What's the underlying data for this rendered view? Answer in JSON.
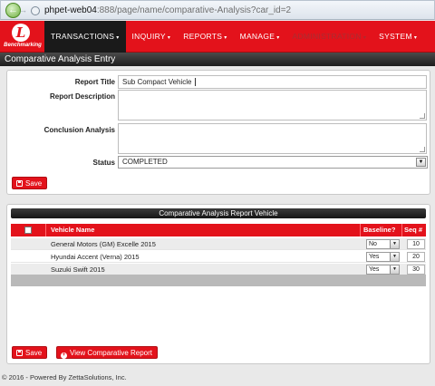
{
  "browser": {
    "url_host": "phpet-web04",
    "url_rest": ":888/page/name/comparative-Analysis?car_id=2"
  },
  "nav": {
    "logo_letter": "L",
    "logo_text": "Benchmarking",
    "items": [
      {
        "label": "TRANSACTIONS",
        "active": true
      },
      {
        "label": "INQUIRY"
      },
      {
        "label": "REPORTS"
      },
      {
        "label": "MANAGE"
      },
      {
        "label": "ADMINISTRATION",
        "dim": true
      },
      {
        "label": "SYSTEM"
      }
    ],
    "caret": "▾"
  },
  "page_title": "Comparative Analysis Entry",
  "form": {
    "report_title_label": "Report Title",
    "report_title_value": "Sub Compact Vehicle",
    "report_description_label": "Report Description",
    "report_description_value": "",
    "conclusion_label": "Conclusion Analysis",
    "conclusion_value": "",
    "status_label": "Status",
    "status_value": "COMPLETED",
    "save_label": "Save"
  },
  "table": {
    "title": "Comparative Analysis Report Vehicle",
    "col_vehicle": "Vehicle Name",
    "col_baseline": "Baseline?",
    "col_seq": "Seq #",
    "rows": [
      {
        "name": "General Motors (GM) Excelle 2015",
        "baseline": "No",
        "seq": "10"
      },
      {
        "name": "Hyundai Accent (Verna) 2015",
        "baseline": "Yes",
        "seq": "20"
      },
      {
        "name": "Suzuki Swift 2015",
        "baseline": "Yes",
        "seq": "30"
      }
    ],
    "save_label": "Save",
    "view_report_label": "View Comparative Report"
  },
  "footer": "© 2016 - Powered By ZettaSolutions, Inc."
}
